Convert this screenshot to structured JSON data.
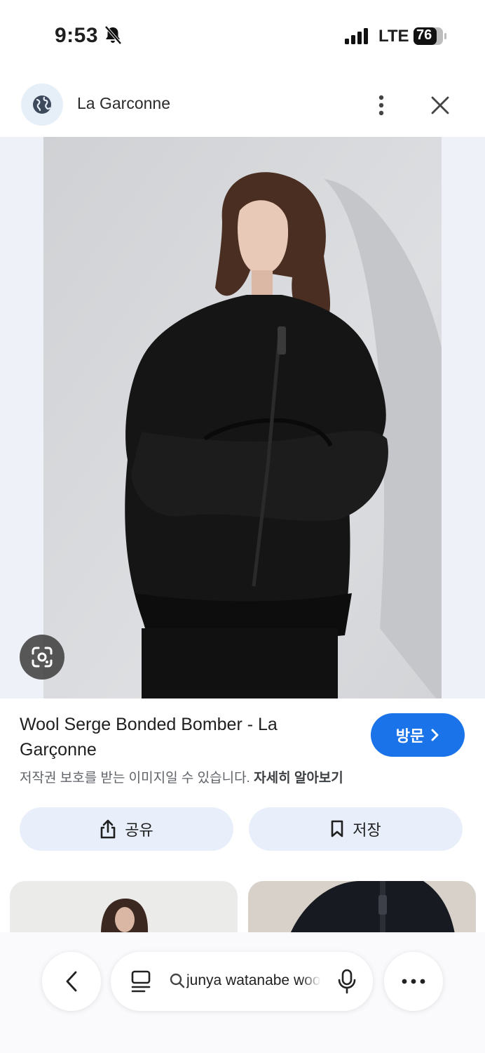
{
  "status_bar": {
    "time": "9:53",
    "network": "LTE",
    "battery": "76"
  },
  "header": {
    "site_name": "La Garconne"
  },
  "result": {
    "title": "Wool Serge Bonded Bomber - La Garçonne",
    "visit_label": "방문",
    "copyright_notice": "저작권 보호를 받는 이미지일 수 있습니다.",
    "learn_more": "자세히 알아보기",
    "share_label": "공유",
    "save_label": "저장"
  },
  "search": {
    "query": "junya watanabe wool"
  },
  "colors": {
    "accent": "#1a73e8",
    "pill_bg": "#e8effa"
  }
}
